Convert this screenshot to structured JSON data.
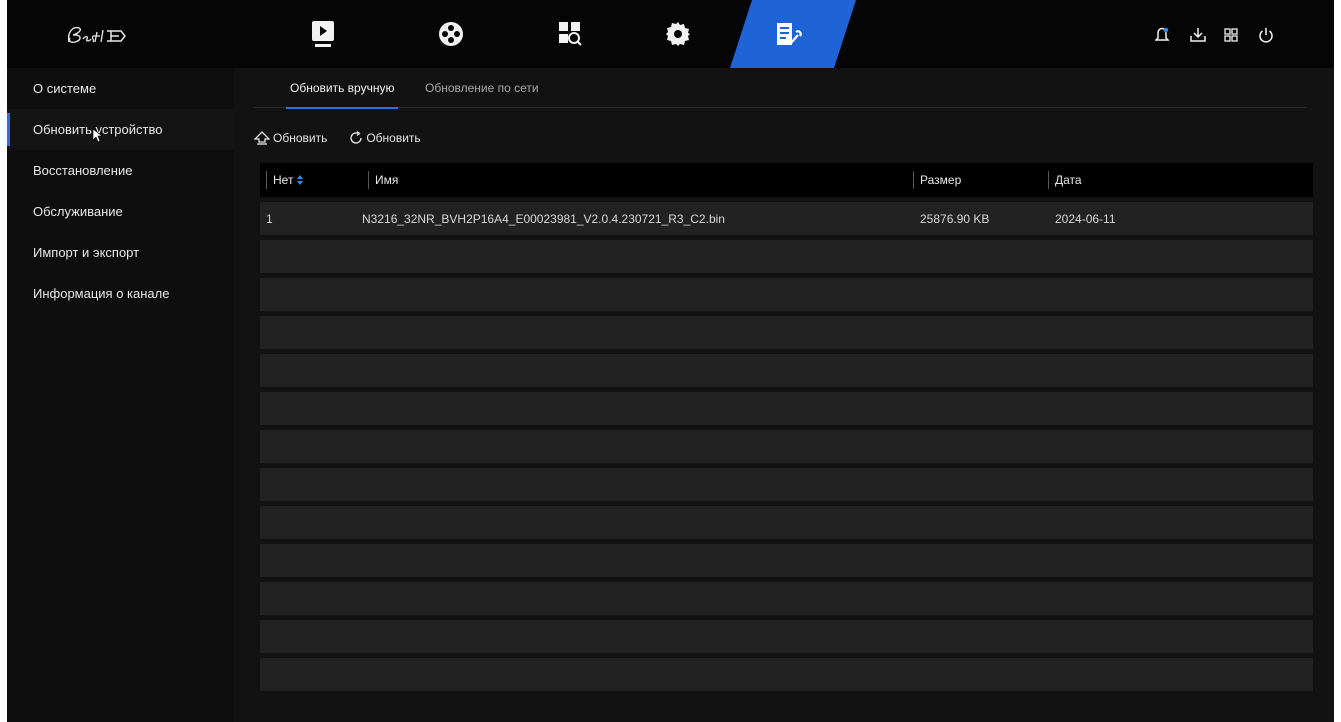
{
  "app": {
    "logo_text": "Bestip"
  },
  "topnav": {
    "icons": [
      "playback-icon",
      "hdd-reel-icon",
      "search-screen-icon",
      "gear-icon",
      "maintenance-icon"
    ],
    "active_index": 4,
    "accent_color": "#1e64d6",
    "right_icons": [
      "alarm-bell-icon",
      "download-icon",
      "layout-grid-icon",
      "power-icon"
    ]
  },
  "sidebar": {
    "items": [
      {
        "label": "О системе"
      },
      {
        "label": "Обновить устройство"
      },
      {
        "label": "Восстановление"
      },
      {
        "label": "Обслуживание"
      },
      {
        "label": "Импорт и экспорт"
      },
      {
        "label": "Информация о канале"
      }
    ],
    "active_index": 1
  },
  "tabs": [
    {
      "label": "Обновить вручную"
    },
    {
      "label": "Обновление по сети"
    }
  ],
  "toolbar": {
    "upgrade_label": "Обновить",
    "refresh_label": "Обновить"
  },
  "table": {
    "columns": [
      "Нет",
      "Имя",
      "Размер",
      "Дата"
    ],
    "rows": [
      {
        "no": "1",
        "name": "N3216_32NR_BVH2P16A4_E00023981_V2.0.4.230721_R3_C2.bin",
        "size": "25876.90 KB",
        "date": "2024-06-11"
      }
    ]
  }
}
